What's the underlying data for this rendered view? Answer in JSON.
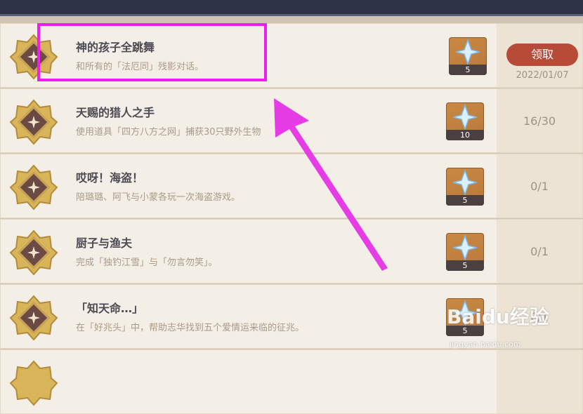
{
  "achievements": [
    {
      "title": "神的孩子全跳舞",
      "desc": "和所有的「法厄同」残影对话。",
      "reward_qty": "5",
      "status": "claim",
      "claim_label": "领取",
      "date": "2022/01/07"
    },
    {
      "title": "天赐的猎人之手",
      "desc": "使用道具「四方八方之网」捕获30只野外生物",
      "reward_qty": "10",
      "status": "progress",
      "progress": "16/30"
    },
    {
      "title": "哎呀！海盗！",
      "desc": "陪璐璐、阿飞与小蒙各玩一次海盗游戏。",
      "reward_qty": "5",
      "status": "progress",
      "progress": "0/1"
    },
    {
      "title": "厨子与渔夫",
      "desc": "完成「独钓江雪」与「勿言勿笑」。",
      "reward_qty": "5",
      "status": "progress",
      "progress": "0/1"
    },
    {
      "title": "「知天命…」",
      "desc": "在「好兆头」中，帮助志华找到五个爱情运来临的征兆。",
      "reward_qty": "5",
      "status": "progress",
      "progress": "0/1"
    }
  ],
  "watermark": {
    "brand": "Baidu经验",
    "url": "jingyan.baidu.com"
  },
  "colors": {
    "highlight": "#f21cf2",
    "claim": "#b64b38"
  }
}
